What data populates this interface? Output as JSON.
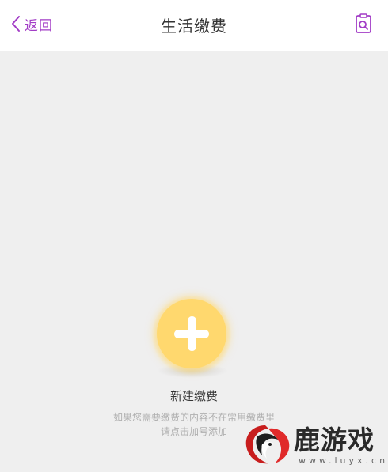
{
  "header": {
    "back_label": "返回",
    "title": "生活缴费",
    "history_icon": "document-search-icon"
  },
  "empty_state": {
    "add_icon": "plus-circle-icon",
    "label": "新建缴费",
    "hint_line1": "如果您需要缴费的内容不在常用缴费里",
    "hint_line2": "请点击加号添加"
  },
  "watermark": {
    "name": "鹿游戏",
    "url": "www.luyx.cn"
  },
  "colors": {
    "accent": "#a23cc6",
    "background": "#efefef",
    "add_button": "#ffd86e"
  }
}
